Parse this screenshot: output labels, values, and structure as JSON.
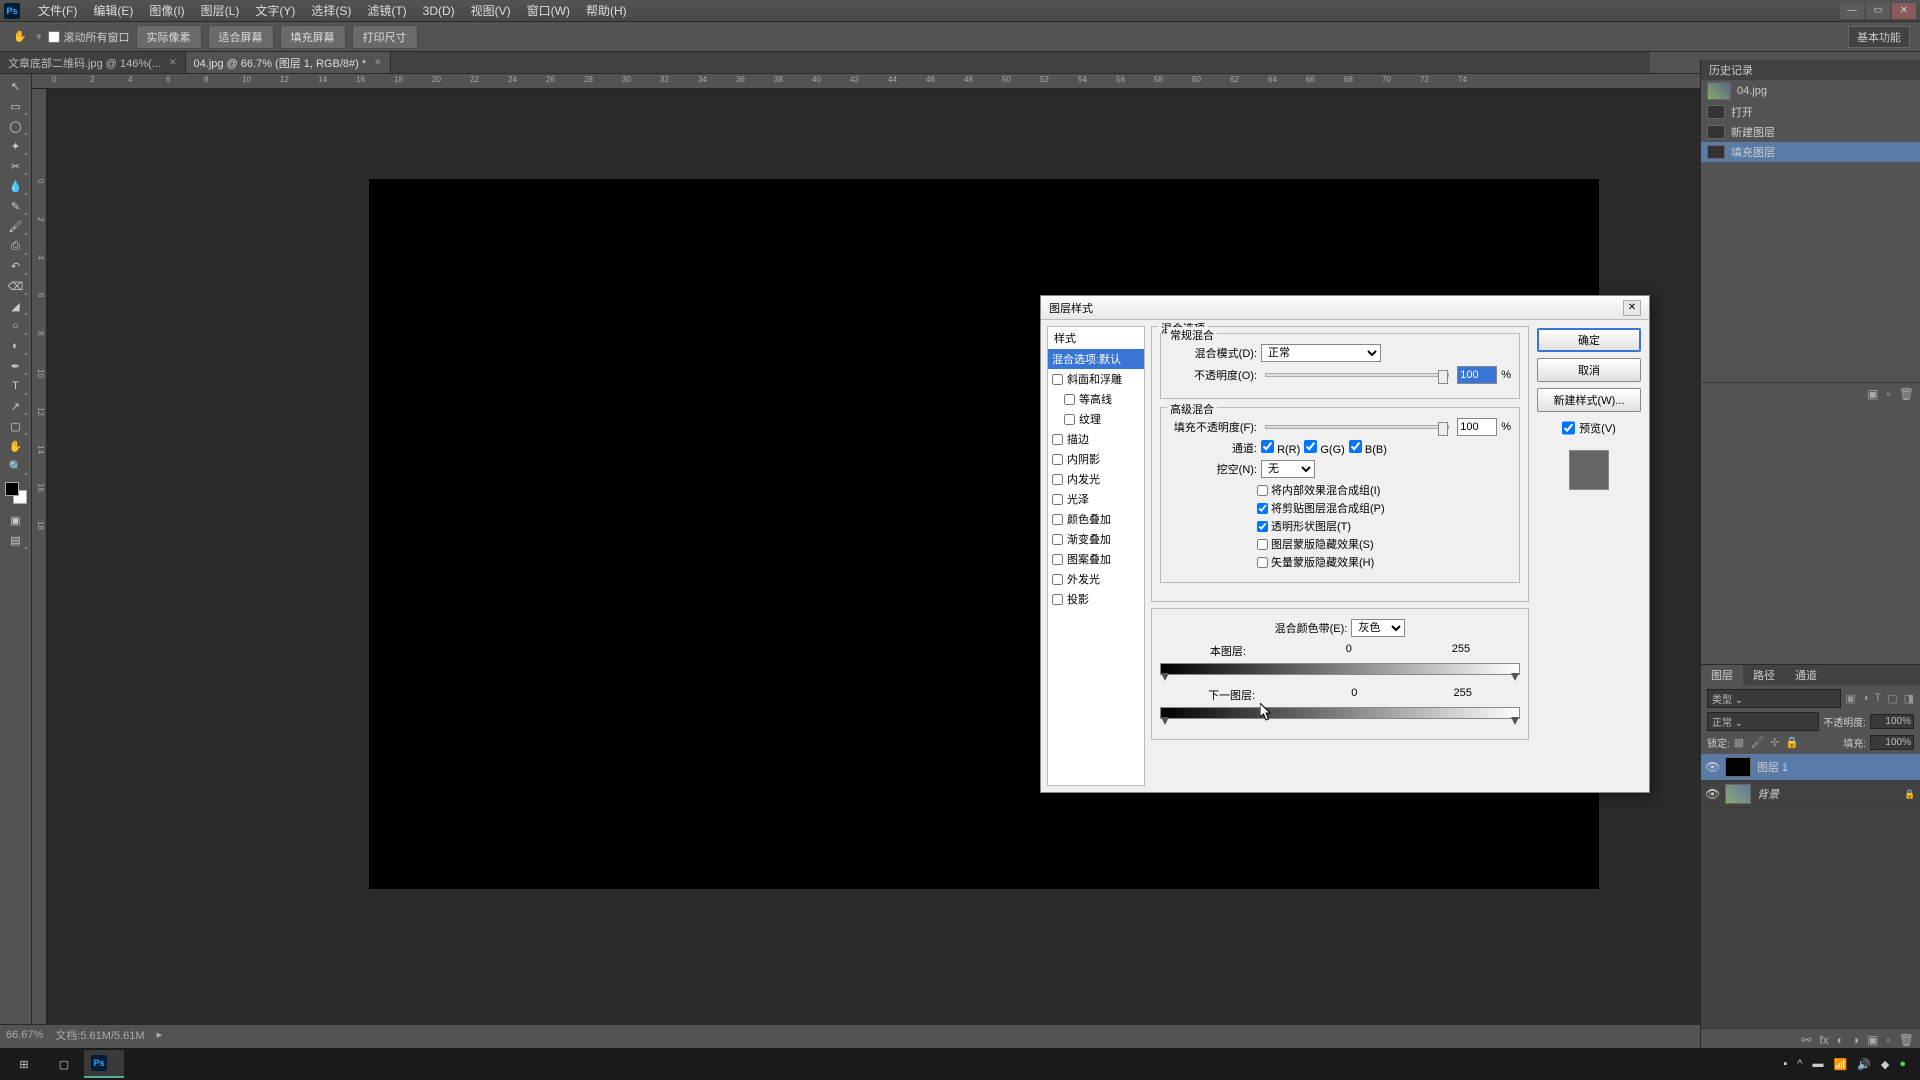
{
  "menu": [
    "文件(F)",
    "编辑(E)",
    "图像(I)",
    "图层(L)",
    "文字(Y)",
    "选择(S)",
    "滤镜(T)",
    "3D(D)",
    "视图(V)",
    "窗口(W)",
    "帮助(H)"
  ],
  "options": {
    "scroll_all": "滚动所有窗口",
    "actual": "实际像素",
    "fit_screen": "适合屏幕",
    "fill_screen": "填充屏幕",
    "print_size": "打印尺寸",
    "basic_func": "基本功能"
  },
  "tabs": [
    {
      "title": "文章底部二维码.jpg @ 146%(...",
      "active": false
    },
    {
      "title": "04.jpg @ 66.7% (图层 1, RGB/8#) *",
      "active": true
    }
  ],
  "ruler_h": [
    "0",
    "2",
    "4",
    "6",
    "8",
    "10",
    "12",
    "14",
    "16",
    "18",
    "20",
    "22",
    "24",
    "26",
    "28",
    "30",
    "32",
    "34",
    "36",
    "38",
    "40",
    "42",
    "44",
    "46",
    "48",
    "50",
    "52",
    "54",
    "56",
    "58",
    "60",
    "62",
    "64",
    "66",
    "68",
    "70",
    "72",
    "74"
  ],
  "ruler_v": [
    "0",
    "2",
    "4",
    "6",
    "8",
    "10",
    "12",
    "14",
    "16",
    "18"
  ],
  "status": {
    "zoom": "66.67%",
    "doc": "文档:5.61M/5.61M"
  },
  "history": {
    "title": "历史记录",
    "doc": "04.jpg",
    "items": [
      "打开",
      "新建图层",
      "填充图层"
    ]
  },
  "layers": {
    "tabs": [
      "图层",
      "路径",
      "通道"
    ],
    "kind": "类型",
    "blend": "正常",
    "opacity_label": "不透明度:",
    "opacity": "100%",
    "lock_label": "锁定:",
    "fill_label": "填充:",
    "fill": "100%",
    "list": [
      {
        "name": "图层 1",
        "sel": true,
        "thumb": "black"
      },
      {
        "name": "背景",
        "sel": false,
        "thumb": "bg",
        "locked": true
      }
    ]
  },
  "dialog": {
    "title": "图层样式",
    "styles_header": "样式",
    "styles": [
      {
        "label": "混合选项:默认",
        "sel": true,
        "nochk": true
      },
      {
        "label": "斜面和浮雕"
      },
      {
        "label": "等高线",
        "indent": true
      },
      {
        "label": "纹理",
        "indent": true
      },
      {
        "label": "描边"
      },
      {
        "label": "内阴影"
      },
      {
        "label": "内发光"
      },
      {
        "label": "光泽"
      },
      {
        "label": "颜色叠加"
      },
      {
        "label": "渐变叠加"
      },
      {
        "label": "图案叠加"
      },
      {
        "label": "外发光"
      },
      {
        "label": "投影"
      }
    ],
    "blend_opts": "混合选项",
    "general": "常规混合",
    "blend_mode": "混合模式(D):",
    "blend_mode_val": "正常",
    "opacity": "不透明度(O):",
    "opacity_val": "100",
    "pct": "%",
    "advanced": "高级混合",
    "fill_opacity": "填充不透明度(F):",
    "fill_val": "100",
    "channels": "通道:",
    "chR": "R(R)",
    "chG": "G(G)",
    "chB": "B(B)",
    "knockout": "挖空(N):",
    "knockout_val": "无",
    "c1": "将内部效果混合成组(I)",
    "c2": "将剪贴图层混合成组(P)",
    "c3": "透明形状图层(T)",
    "c4": "图层蒙版隐藏效果(S)",
    "c5": "矢量蒙版隐藏效果(H)",
    "blend_if": "混合颜色带(E):",
    "blend_if_val": "灰色",
    "this_layer": "本图层:",
    "underlying": "下一图层:",
    "v0": "0",
    "v255": "255",
    "btn_ok": "确定",
    "btn_cancel": "取消",
    "btn_new": "新建样式(W)...",
    "preview": "预览(V)"
  }
}
